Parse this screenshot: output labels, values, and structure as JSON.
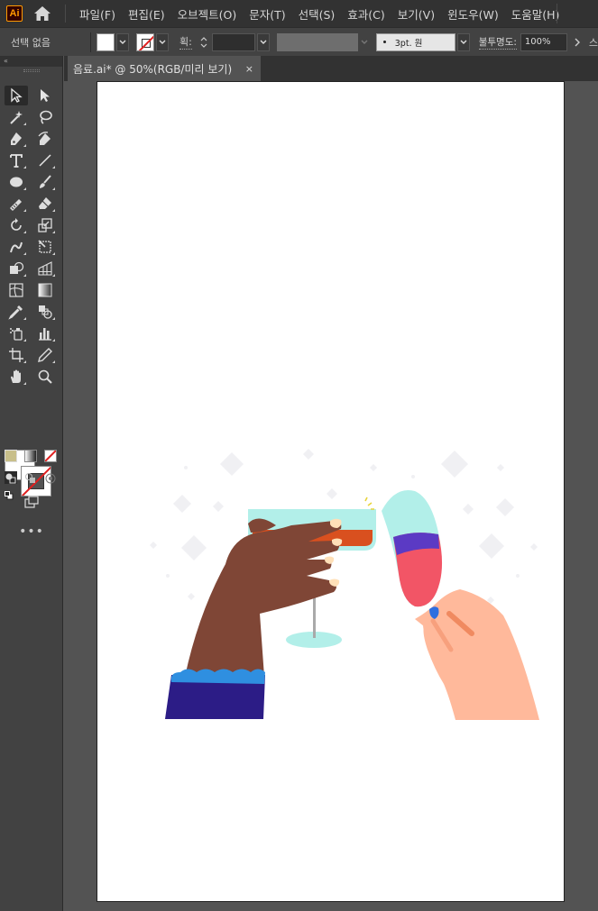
{
  "app": {
    "logo_text": "Ai"
  },
  "menubar": {
    "items": [
      "파일(F)",
      "편집(E)",
      "오브젝트(O)",
      "문자(T)",
      "선택(S)",
      "효과(C)",
      "보기(V)",
      "윈도우(W)",
      "도움말(H)"
    ]
  },
  "controlbar": {
    "selection_label": "선택 없음",
    "stroke_label": "획:",
    "brush_label": "3pt. 원",
    "opacity_label": "불투명도:",
    "opacity_value": "100%",
    "trailing_label": "스"
  },
  "tools_panel": {
    "collapse_glyph": "«",
    "more_glyph": "•••"
  },
  "document": {
    "tab_title": "음료.ai* @ 50%(RGB/미리 보기)",
    "close_glyph": "×"
  },
  "colors": {
    "skin_dark": "#7f4636",
    "skin_light": "#ffb99b",
    "sleeve": "#2c1c86",
    "cuff": "#2f8fe0",
    "glass": "#b2efe9",
    "drink_orange": "#d9501f",
    "wine_red": "#f25566",
    "wine_purple": "#5b3ac4",
    "sparkle": "#f0f0f3",
    "nail": "#ffe0b8"
  }
}
